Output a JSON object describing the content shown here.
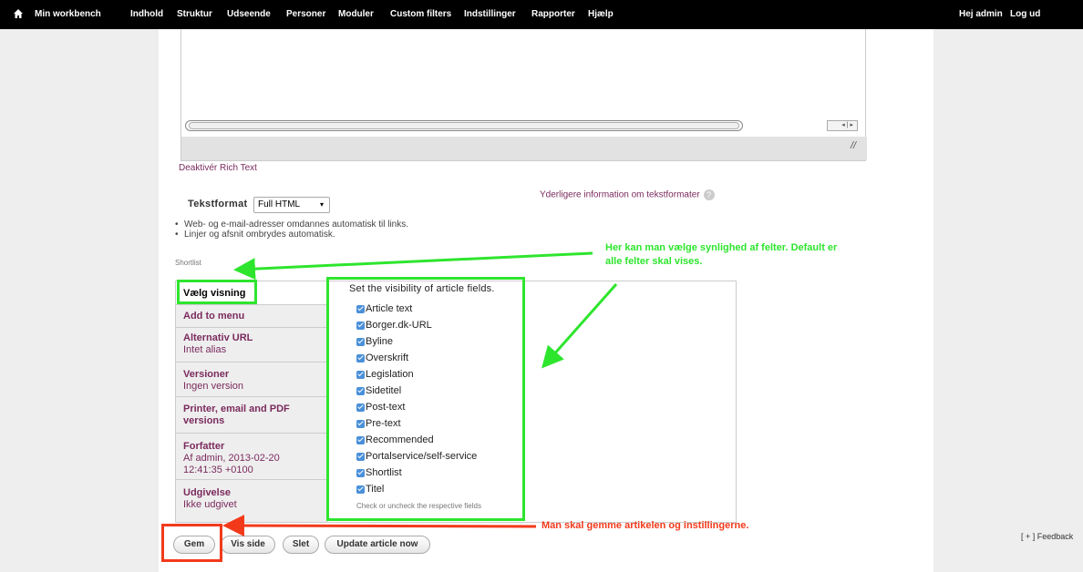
{
  "toolbar": {
    "home_icon": "home-icon",
    "items": [
      "Min workbench",
      "Indhold",
      "Struktur",
      "Udseende",
      "Personer",
      "Moduler",
      "Custom filters",
      "Indstillinger",
      "Rapporter",
      "Hjælp"
    ],
    "user_greeting": "Hej admin",
    "logout": "Log ud"
  },
  "editor": {
    "deactivate_rich_text": "Deaktivér Rich Text",
    "text_format_label": "Tekstformat",
    "text_format_value": "Full HTML",
    "more_info_link": "Yderligere information om tekstformater",
    "tips": [
      "Web- og e-mail-adresser omdannes automatisk til links.",
      "Linjer og afsnit ombrydes automatisk."
    ]
  },
  "shortlist_label": "Shortlist",
  "vertical_tabs": [
    {
      "title": "Vælg visning",
      "summary": ""
    },
    {
      "title": "Add to menu",
      "summary": ""
    },
    {
      "title": "Alternativ URL",
      "summary": "Intet alias"
    },
    {
      "title": "Versioner",
      "summary": "Ingen version"
    },
    {
      "title": "Printer, email and PDF versions",
      "summary": ""
    },
    {
      "title": "Forfatter",
      "summary": "Af admin, 2013-02-20 12:41:35 +0100"
    },
    {
      "title": "Udgivelse",
      "summary": "Ikke udgivet"
    }
  ],
  "visibility": {
    "description": "Set the visibility of article fields.",
    "fields": [
      "Article text",
      "Borger.dk-URL",
      "Byline",
      "Overskrift",
      "Legislation",
      "Sidetitel",
      "Post-text",
      "Pre-text",
      "Recommended",
      "Portalservice/self-service",
      "Shortlist",
      "Titel"
    ],
    "hint": "Check or uncheck the respective fields"
  },
  "buttons": {
    "save": "Gem",
    "view": "Vis side",
    "delete": "Slet",
    "update": "Update article now"
  },
  "feedback": "[ + ] Feedback",
  "annotations": {
    "green_note_line1": "Her kan man vælge synlighed af felter. Default er",
    "green_note_line2": "alle felter skal vises.",
    "red_note": "Man skal gemme artikelen og instillingerne.",
    "green_color": "#2ee52e",
    "red_color": "#f23a1b"
  }
}
